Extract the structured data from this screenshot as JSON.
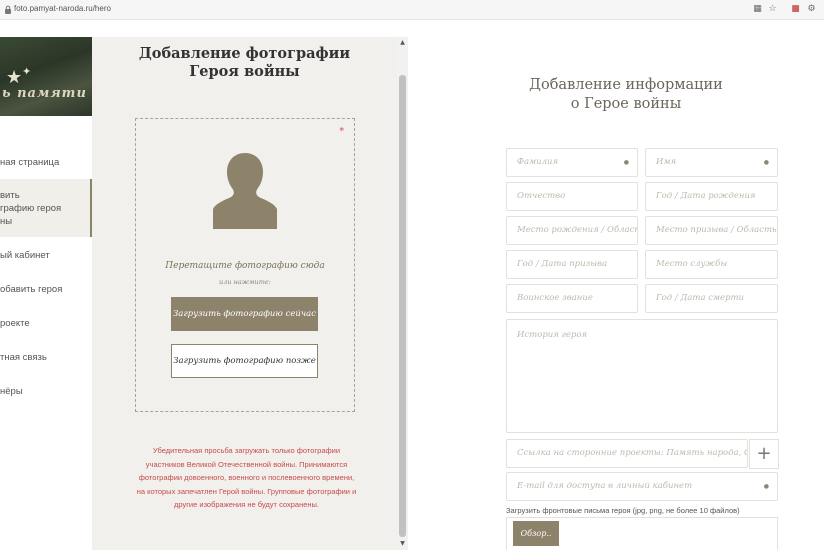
{
  "browser": {
    "url": "foto.pamyat-naroda.ru/hero",
    "icons": [
      "translate-icon",
      "star-icon",
      "extension-icon",
      "settings-icon"
    ]
  },
  "nav": {
    "banner_text": "ь памяти",
    "items": [
      {
        "label": "ная страница"
      },
      {
        "label": "вить\nграфию героя\nны"
      },
      {
        "label": "ый кабинет"
      },
      {
        "label": "обавить героя"
      },
      {
        "label": "роекте"
      },
      {
        "label": "тная связь"
      },
      {
        "label": "нёры"
      }
    ]
  },
  "upload": {
    "title": "Добавление фотографии\nГероя войны",
    "required_mark": "*",
    "drag_text": "Перетащите фотографию сюда",
    "or_text": "или нажмите:",
    "upload_now": "Загрузить фотографию сейчас",
    "upload_later": "Загрузить фотографию позже",
    "note": "Убедительная просьба загружать только фотографии участников Великой Отечественной войны. Принимаются фотографии довоенного, военного и послевоенного времени, на которых запечатлен Герой войны. Групповые фотографии и другие изображения не будут сохранены."
  },
  "form": {
    "title": "Добавление информации\nо Герое войны",
    "surname": "Фамилия",
    "name": "Имя",
    "patronymic": "Отчество",
    "birth_date": "Год / Дата рождения",
    "birth_place": "Место рождения / Область",
    "conscription_place": "Место призыва / Область",
    "conscription_date": "Год / Дата призыва",
    "service_place": "Место службы",
    "rank": "Воинское звание",
    "death_date": "Год / Дата смерти",
    "history": "История героя",
    "links": "Ссылка на сторонние проекты: Память народа, ОБД Мемориал",
    "email": "E-mail для доступа в личный кабинет",
    "required_mark": "*",
    "upload_label": "Загрузить фронтовые письма героя (jpg, png, не более 10 файлов)",
    "browse": "Обзор..",
    "plus": "+"
  },
  "colors": {
    "accent": "#8d836b",
    "warning": "#c84b4b",
    "panel": "#f1f0ec"
  }
}
